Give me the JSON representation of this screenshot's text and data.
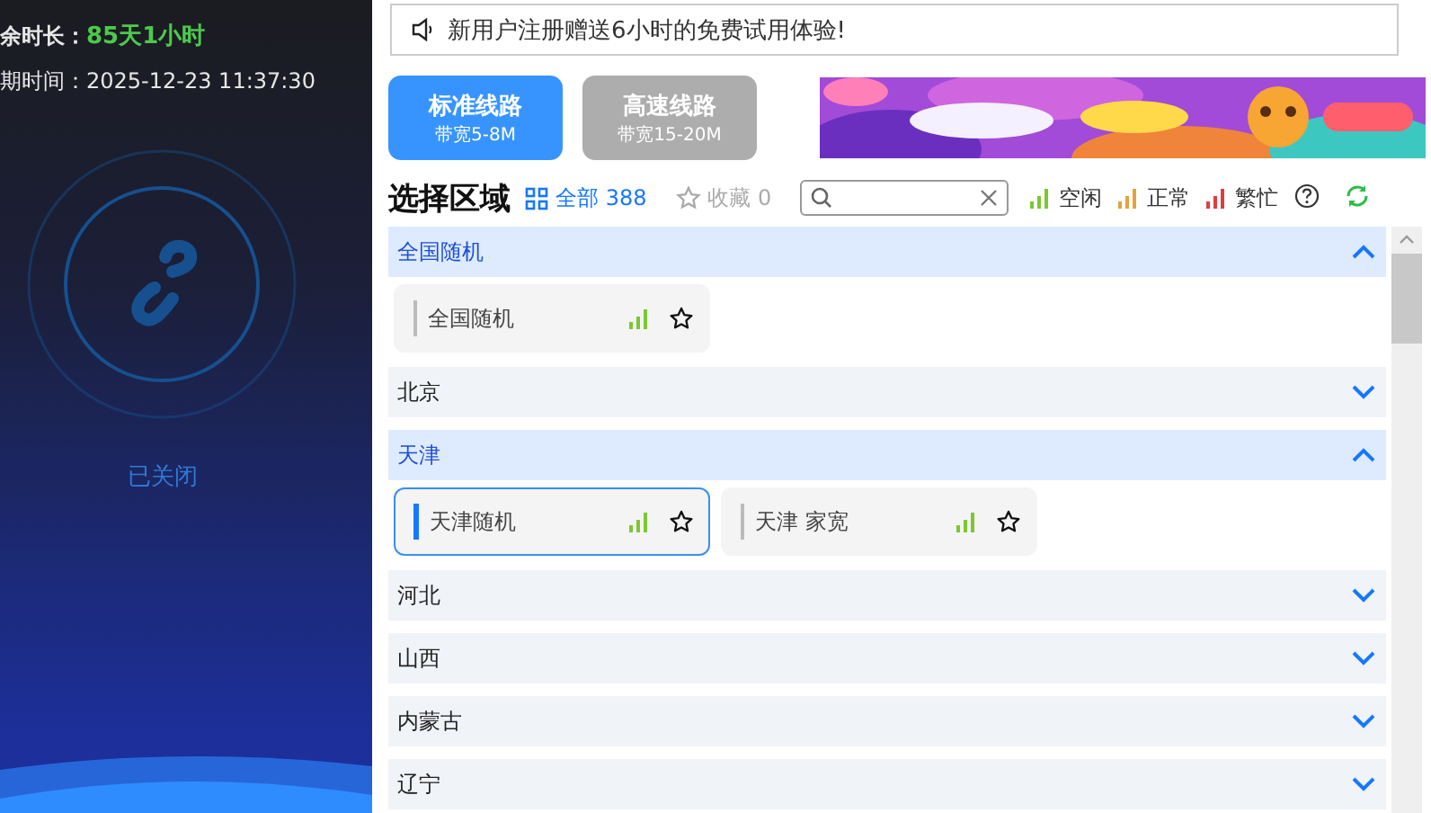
{
  "account": {
    "remaining_label": "余时长：",
    "remaining_value": "85天1小时",
    "expiry_label": "期时间：",
    "expiry_value": "2025-12-23 11:37:30"
  },
  "connection": {
    "connected": false,
    "status": "已关闭"
  },
  "notice": {
    "text": "新用户注册赠送6小时的免费试用体验!"
  },
  "lines": [
    {
      "title": "标准线路",
      "subtitle": "带宽5-8M",
      "selected": true
    },
    {
      "title": "高速线路",
      "subtitle": "带宽15-20M",
      "selected": false
    }
  ],
  "region_header": {
    "title": "选择区域",
    "all_label": "全部",
    "all_count": "388",
    "favorites_label": "收藏",
    "favorites_count": "0"
  },
  "legend": [
    {
      "color": "#7cc832",
      "label": "空闲"
    },
    {
      "color": "#e6a23c",
      "label": "正常"
    },
    {
      "color": "#e03c3c",
      "label": "繁忙"
    }
  ],
  "regions": [
    {
      "name": "全国随机",
      "expanded": true,
      "nodes": [
        {
          "name": "全国随机",
          "color": "#7cc832",
          "selected": false
        }
      ]
    },
    {
      "name": "北京",
      "expanded": false
    },
    {
      "name": "天津",
      "expanded": true,
      "nodes": [
        {
          "name": "天津随机",
          "color": "#7cc832",
          "selected": true
        },
        {
          "name": "天津 家宽",
          "color": "#7cc832",
          "selected": false
        }
      ]
    },
    {
      "name": "河北",
      "expanded": false
    },
    {
      "name": "山西",
      "expanded": false
    },
    {
      "name": "内蒙古",
      "expanded": false
    },
    {
      "name": "辽宁",
      "expanded": false
    }
  ]
}
